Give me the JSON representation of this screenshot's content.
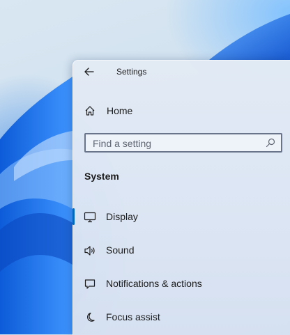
{
  "window": {
    "title": "Settings",
    "back_icon": "back-arrow-icon"
  },
  "home": {
    "label": "Home",
    "icon": "home-icon"
  },
  "search": {
    "placeholder": "Find a setting",
    "value": "",
    "icon": "search-icon"
  },
  "section_title": "System",
  "nav": {
    "items": [
      {
        "label": "Display",
        "icon": "monitor-icon",
        "selected": true
      },
      {
        "label": "Sound",
        "icon": "speaker-icon",
        "selected": false
      },
      {
        "label": "Notifications & actions",
        "icon": "notification-icon",
        "selected": false
      },
      {
        "label": "Focus assist",
        "icon": "moon-icon",
        "selected": false
      }
    ]
  },
  "colors": {
    "accent": "#0067c0",
    "wallpaper_blue": "#1e78e6"
  }
}
